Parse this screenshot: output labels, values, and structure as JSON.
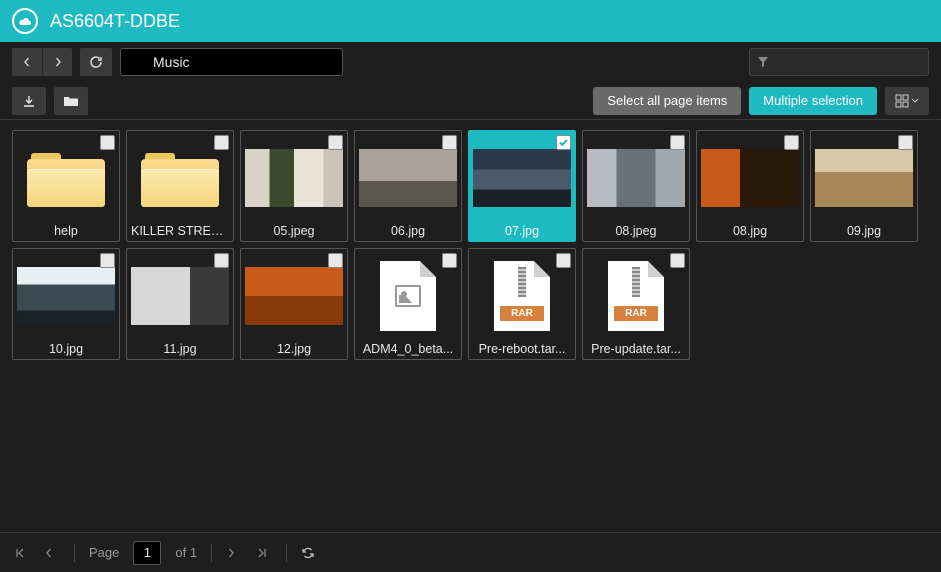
{
  "header": {
    "title": "AS6604T-DDBE"
  },
  "path": {
    "value": "Music"
  },
  "filter": {
    "placeholder": ""
  },
  "actions": {
    "select_all": "Select all page items",
    "multiple_selection": "Multiple selection"
  },
  "items": [
    {
      "label": "help",
      "kind": "folder",
      "selected": false
    },
    {
      "label": "KILLER STREET...",
      "kind": "folder",
      "selected": false
    },
    {
      "label": "05.jpeg",
      "kind": "photo",
      "cls": "p05",
      "selected": false
    },
    {
      "label": "06.jpg",
      "kind": "photo",
      "cls": "p06",
      "selected": false
    },
    {
      "label": "07.jpg",
      "kind": "photo",
      "cls": "p07",
      "selected": true
    },
    {
      "label": "08.jpeg",
      "kind": "photo",
      "cls": "p08a",
      "selected": false
    },
    {
      "label": "08.jpg",
      "kind": "photo",
      "cls": "p08b",
      "selected": false
    },
    {
      "label": "09.jpg",
      "kind": "photo",
      "cls": "p09",
      "selected": false
    },
    {
      "label": "10.jpg",
      "kind": "photo",
      "cls": "p10",
      "selected": false
    },
    {
      "label": "11.jpg",
      "kind": "photo",
      "cls": "p11",
      "selected": false
    },
    {
      "label": "12.jpg",
      "kind": "photo",
      "cls": "p12",
      "selected": false
    },
    {
      "label": "ADM4_0_beta...",
      "kind": "doc",
      "selected": false
    },
    {
      "label": "Pre-reboot.tar...",
      "kind": "rar",
      "selected": false
    },
    {
      "label": "Pre-update.tar...",
      "kind": "rar",
      "selected": false
    }
  ],
  "rar_tag": "RAR",
  "pager": {
    "page_label": "Page",
    "current": "1",
    "of_text": "of 1"
  }
}
